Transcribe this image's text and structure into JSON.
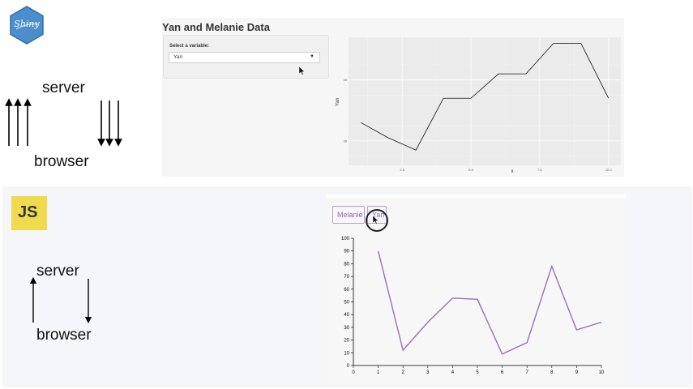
{
  "top": {
    "shiny_logo_text": "Shiny",
    "server_label": "server",
    "browser_label": "browser",
    "app": {
      "title": "Yan and Melanie Data",
      "select_label": "Select a variable:",
      "select_value": "Yan"
    }
  },
  "bottom": {
    "js_logo_text": "JS",
    "server_label": "server",
    "browser_label": "browser",
    "buttons": {
      "melanie": "Melanie",
      "yan": "Yan"
    }
  },
  "colors": {
    "shiny_blue": "#4c8ecb",
    "js_yellow": "#f0db4f",
    "purple_line": "#9a70b0",
    "ggplot_bg": "#ebebeb"
  },
  "chart_data": [
    {
      "type": "line",
      "xlabel": "x",
      "ylabel": "Yan",
      "x": [
        1,
        2,
        3,
        4,
        5,
        6,
        7,
        8,
        9,
        10
      ],
      "values": [
        33,
        30.5,
        28.5,
        37,
        37,
        41,
        41,
        46,
        46,
        37
      ],
      "x_ticks": [
        "2.5",
        "5.0",
        "7.5",
        "10.0"
      ],
      "y_ticks": [
        "30",
        "40",
        "50"
      ],
      "grid": true
    },
    {
      "type": "line",
      "x": [
        1,
        2,
        3,
        4,
        5,
        6,
        7,
        8,
        9,
        10
      ],
      "values": [
        90,
        12,
        34,
        53,
        52,
        9,
        18,
        78,
        28,
        34
      ],
      "xlim": [
        0,
        10
      ],
      "ylim": [
        0,
        100
      ],
      "x_ticks": [
        "0",
        "1",
        "2",
        "3",
        "4",
        "5",
        "6",
        "7",
        "8",
        "9",
        "10"
      ],
      "y_ticks": [
        "0",
        "10",
        "20",
        "30",
        "40",
        "50",
        "60",
        "70",
        "80",
        "90",
        "100"
      ],
      "grid": false
    }
  ]
}
